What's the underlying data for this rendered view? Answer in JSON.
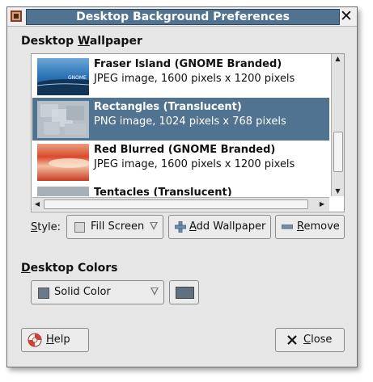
{
  "window": {
    "title": "Desktop Background Preferences",
    "close_glyph": "✕"
  },
  "wallpaper": {
    "heading_pre": "Desktop ",
    "heading_u": "W",
    "heading_post": "allpaper",
    "items": [
      {
        "name": "Fraser Island (GNOME Branded)",
        "desc": "JPEG image, 1600 pixels x 1200 pixels",
        "thumb_text": "GNOME",
        "selected": false
      },
      {
        "name": "Rectangles (Translucent)",
        "desc": "PNG image, 1024 pixels x 768 pixels",
        "selected": true
      },
      {
        "name": "Red Blurred (GNOME Branded)",
        "desc": "JPEG image, 1600 pixels x 1200 pixels",
        "selected": false
      },
      {
        "name": "Tentacles (Translucent)",
        "selected": false
      }
    ]
  },
  "style": {
    "label_u": "S",
    "label_post": "tyle:",
    "value": "Fill Screen"
  },
  "buttons": {
    "add_u": "A",
    "add_post": "dd Wallpaper",
    "remove_u": "R",
    "remove_post": "emove",
    "help_u": "H",
    "help_post": "elp",
    "close_u": "C",
    "close_post": "lose"
  },
  "colors": {
    "heading_u": "D",
    "heading_post": "esktop Colors",
    "mode": "Solid Color",
    "swatch": "#5f7080"
  },
  "accent": "#4f7390"
}
